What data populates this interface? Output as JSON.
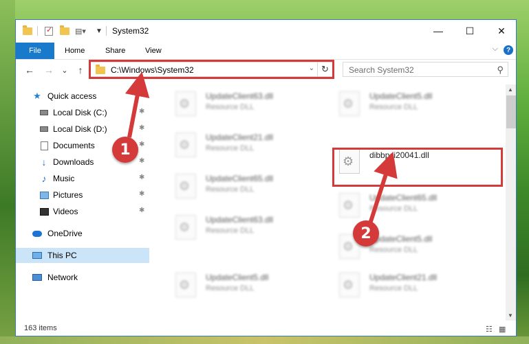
{
  "window": {
    "title": "System32",
    "minimize_label": "—",
    "maximize_label": "☐",
    "close_label": "✕"
  },
  "ribbon": {
    "tabs": [
      "File",
      "Home",
      "Share",
      "View"
    ],
    "help_label": "?",
    "collapse_label": "⌵"
  },
  "nav": {
    "back_label": "←",
    "forward_label": "→",
    "recent_label": "⌄",
    "up_label": "↑",
    "address": "C:\\Windows\\System32",
    "refresh_label": "↻",
    "search_placeholder": "Search System32",
    "search_icon": "⚲"
  },
  "sidebar": {
    "items": [
      {
        "label": "Quick access",
        "icon": "star-icon",
        "pinned": false
      },
      {
        "label": "Local Disk (C:)",
        "icon": "drive-icon",
        "pinned": true
      },
      {
        "label": "Local Disk (D:)",
        "icon": "drive-icon",
        "pinned": true
      },
      {
        "label": "Documents",
        "icon": "documents-icon",
        "pinned": true
      },
      {
        "label": "Downloads",
        "icon": "downloads-icon",
        "pinned": true
      },
      {
        "label": "Music",
        "icon": "music-icon",
        "pinned": true
      },
      {
        "label": "Pictures",
        "icon": "pictures-icon",
        "pinned": true
      },
      {
        "label": "Videos",
        "icon": "videos-icon",
        "pinned": true
      },
      {
        "label": "OneDrive",
        "icon": "onedrive-icon",
        "pinned": false
      },
      {
        "label": "This PC",
        "icon": "this-pc-icon",
        "pinned": false,
        "selected": true
      },
      {
        "label": "Network",
        "icon": "network-icon",
        "pinned": false
      }
    ],
    "pin_glyph": "📌"
  },
  "files": [
    {
      "name": "UpdateClient63.dll",
      "type": "Resource DLL"
    },
    {
      "name": "UpdateClient5.dll",
      "type": "Resource DLL"
    },
    {
      "name": "UpdateClient21.dll",
      "type": "Resource DLL"
    },
    {
      "name": "dibbpci20041.dll",
      "type": ""
    },
    {
      "name": "UpdateClient65.dll",
      "type": "Resource DLL"
    },
    {
      "name": "UpdateClient65.dll",
      "type": "Resource DLL"
    },
    {
      "name": "UpdateClient63.dll",
      "type": "Resource DLL"
    },
    {
      "name": "UpdateClient5.dll",
      "type": "Resource DLL"
    },
    {
      "name": "UpdateClient5.dll",
      "type": "Resource DLL"
    },
    {
      "name": "UpdateClient21.dll",
      "type": "Resource DLL"
    }
  ],
  "gear_glyph": "⚙",
  "status": {
    "item_count": "163 items",
    "details_view_icon": "☷",
    "large_icons_view_icon": "▦"
  },
  "annotations": {
    "marker_1": "1",
    "marker_2": "2",
    "color": "#d53a3a"
  }
}
